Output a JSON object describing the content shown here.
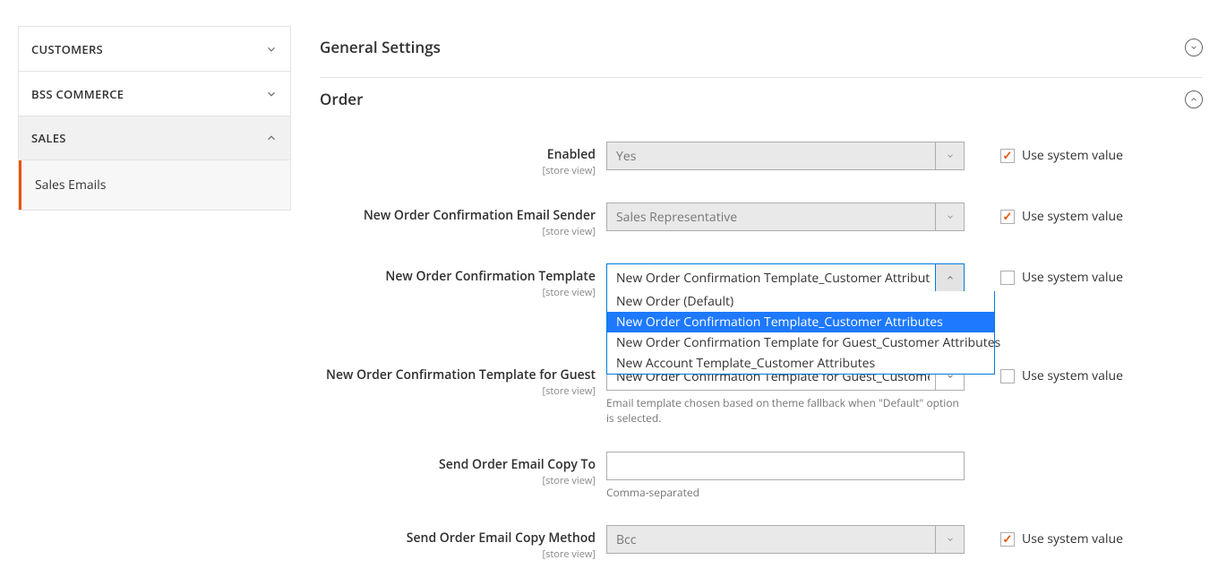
{
  "sidebar": {
    "items": [
      {
        "label": "CUSTOMERS",
        "expanded": false
      },
      {
        "label": "BSS COMMERCE",
        "expanded": false
      },
      {
        "label": "SALES",
        "expanded": true,
        "children": [
          {
            "label": "Sales Emails",
            "active": true
          }
        ]
      }
    ]
  },
  "sections": {
    "general": {
      "title": "General Settings"
    },
    "order": {
      "title": "Order"
    }
  },
  "scope_text": "[store view]",
  "use_system_value_label": "Use system value",
  "fields": {
    "enabled": {
      "label": "Enabled",
      "value": "Yes",
      "use_system": true,
      "disabled": true
    },
    "sender": {
      "label": "New Order Confirmation Email Sender",
      "value": "Sales Representative",
      "use_system": true,
      "disabled": true
    },
    "template": {
      "label": "New Order Confirmation Template",
      "value": "New Order Confirmation Template_Customer Attributes",
      "use_system": false,
      "disabled": false,
      "open": true,
      "options": [
        "New Order (Default)",
        "New Order Confirmation Template_Customer Attributes",
        "New Order Confirmation Template for Guest_Customer Attributes",
        "New Account Template_Customer Attributes"
      ],
      "selected_index": 1
    },
    "template_guest": {
      "label": "New Order Confirmation Template for Guest",
      "value": "New Order Confirmation Template for Guest_Customer Attributes",
      "display_value": "New Order Confirmation Template for Guest_Custome",
      "use_system": false,
      "disabled": false,
      "note": "Email template chosen based on theme fallback when \"Default\" option is selected."
    },
    "copy_to": {
      "label": "Send Order Email Copy To",
      "value": "",
      "note": "Comma-separated"
    },
    "copy_method": {
      "label": "Send Order Email Copy Method",
      "value": "Bcc",
      "use_system": true,
      "disabled": true
    }
  }
}
